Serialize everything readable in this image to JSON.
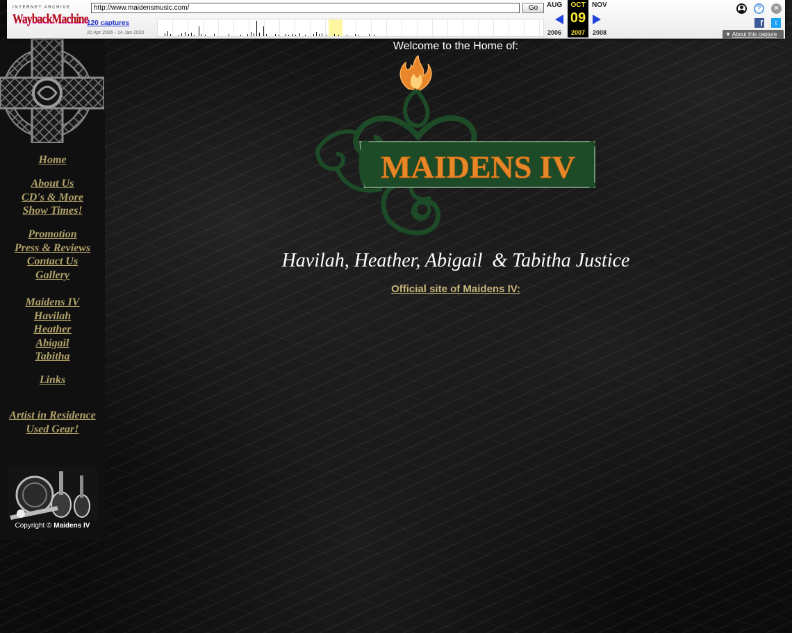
{
  "wayback": {
    "logo_top": "INTERNET ARCHIVE",
    "logo_main": "WaybackMachine",
    "url": "http://www.maidensmusic.com/",
    "go_label": "Go",
    "captures_label": "120 captures",
    "date_range": "20 Apr 2006 - 14 Jan 2020",
    "prev_month": "AUG",
    "current_month": "OCT",
    "next_month": "NOV",
    "current_day": "09",
    "prev_year": "2006",
    "current_year": "2007",
    "next_year": "2008",
    "about_label": "About this capture",
    "help_glyph": "?",
    "close_glyph": "×",
    "facebook_glyph": "f",
    "twitter_glyph": "t"
  },
  "sidebar": {
    "nav_groups": [
      [
        "Home"
      ],
      [
        "About Us",
        "CD's & More",
        "Show Times!"
      ],
      [
        "Promotion",
        "Press & Reviews",
        "Contact Us",
        "Gallery"
      ],
      [
        "Maidens IV",
        "Havilah",
        "Heather",
        "Abigail",
        "Tabitha"
      ],
      [
        "Links"
      ],
      [
        "Artist in Residence",
        "Used Gear!"
      ]
    ],
    "copyright_prefix": "Copyright ©",
    "copyright_name": "Maidens IV"
  },
  "main": {
    "welcome": "Welcome to the Home of:",
    "logo_text": "MAIDENS IV",
    "members": "Havilah, Heather, Abigail  & Tabitha Justice",
    "official_link": "Official site of Maidens IV:"
  },
  "colors": {
    "nav_link": "#b2a36a",
    "logo_green": "#1d4a27",
    "logo_orange": "#e8872a",
    "official_link": "#c7b67a",
    "wayback_accent": "#ffeb33"
  }
}
